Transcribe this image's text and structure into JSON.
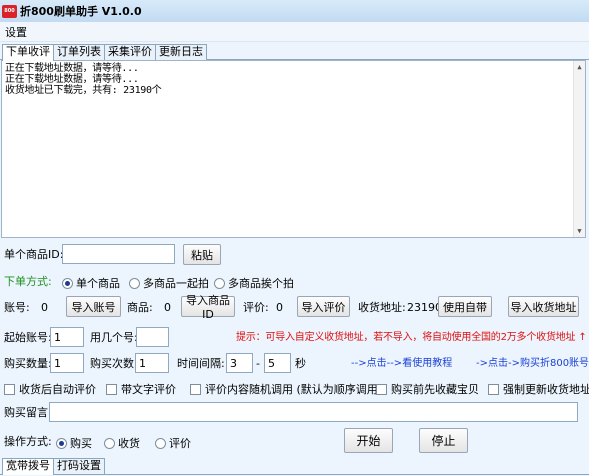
{
  "window": {
    "title": "折800刷单助手 V1.0.0",
    "icon": "zhe800-logo-icon",
    "icon_text": "800"
  },
  "menu": {
    "items": [
      "设置"
    ]
  },
  "tabs": [
    "下单收评",
    "订单列表",
    "采集评价",
    "更新日志"
  ],
  "log": {
    "lines": [
      "正在下载地址数据，请等待...",
      "正在下载地址数据，请等待...",
      "收货地址已下载完，共有: 23190个"
    ]
  },
  "form": {
    "single_item_label": "单个商品ID:",
    "single_item_value": "",
    "paste_button": "粘贴",
    "order_mode_label": "下单方式:",
    "order_modes": [
      "单个商品",
      "多商品一起拍",
      "多商品挨个拍"
    ],
    "order_mode_selected": 0,
    "account_label": "账号:",
    "account_count": "0",
    "import_account_button": "导入账号",
    "goods_label": "商品:",
    "goods_count": "0",
    "import_goods_button": "导入商品ID",
    "review_label": "评价:",
    "review_count": "0",
    "import_review_button": "导入评价",
    "address_label": "收货地址:",
    "address_count": "23190",
    "use_builtin_button": "使用自带",
    "import_address_button": "导入收货地址",
    "start_account_label": "起始账号:",
    "start_account_value": "1",
    "use_count_label": "用几个号:",
    "use_count_value": "",
    "hint_text": "提示：可导入自定义收货地址，若不导入，将自动使用全国的2万多个收货地址 ↑",
    "buy_qty_label": "购买数量:",
    "buy_qty_value": "1",
    "buy_times_label": "购买次数:",
    "buy_times_value": "1",
    "interval_label": "时间间隔:",
    "interval_from": "3",
    "interval_to": "5",
    "interval_sep": "-",
    "interval_unit": "秒",
    "tutorial_link": "-->点击-->看使用教程",
    "buy_account_link": "->点击->购买折800账号",
    "checkboxes": [
      "收货后自动评价",
      "带文字评价",
      "评价内容随机调用 (默认为顺序调用)",
      "购买前先收藏宝贝",
      "强制更新收货地址"
    ],
    "message_label": "购买留言:",
    "message_value": "",
    "operation_label": "操作方式:",
    "operations": [
      "购买",
      "收货",
      "评价"
    ],
    "operation_selected": 0,
    "start_button": "开始",
    "stop_button": "停止"
  },
  "bottom_tabs": [
    "宽带拨号",
    "打码设置"
  ]
}
